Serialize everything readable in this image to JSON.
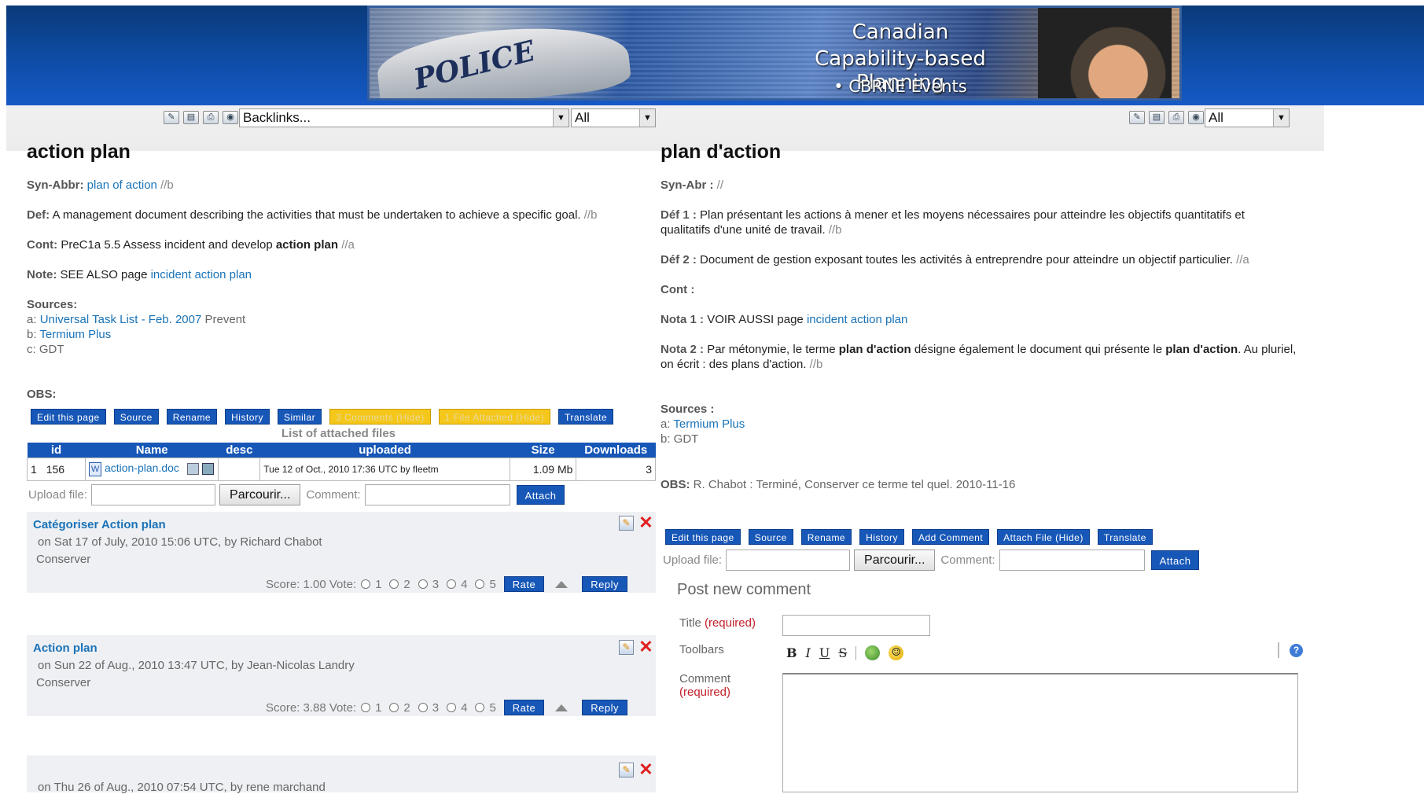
{
  "banner": {
    "line1": "Canadian",
    "line2": "Capability-based Planning",
    "line3": "• CBRNE Events",
    "car_text": "POLICE"
  },
  "toolbar_left": {
    "icons": [
      "edit-icon",
      "notepad-icon",
      "print-icon",
      "eye-icon"
    ],
    "backlinks_select": "Backlinks...",
    "filter_select": "All"
  },
  "toolbar_right": {
    "icons": [
      "edit-icon",
      "notepad-icon",
      "print-icon",
      "eye-icon"
    ],
    "filter_select": "All"
  },
  "left": {
    "title": "action plan",
    "syn_label": "Syn-Abbr:",
    "syn_link": "plan of action",
    "syn_trail": "//b",
    "def_label": "Def:",
    "def_text": "A management document describing the activities that must be undertaken to achieve a specific goal.",
    "def_trail": "//b",
    "cont_label": "Cont:",
    "cont_text": "PreC1a 5.5 Assess incident and develop",
    "cont_bold": "action plan",
    "cont_trail": "//a",
    "note_label": "Note:",
    "note_text": "SEE ALSO page",
    "note_link": "incident action plan",
    "sources_label": "Sources:",
    "src_a_prefix": "a:",
    "src_a_link": "Universal Task List - Feb. 2007",
    "src_a_tail": "Prevent",
    "src_b_prefix": "b:",
    "src_b_link": "Termium Plus",
    "src_c": "c: GDT",
    "obs_label": "OBS:",
    "buttons": [
      "Edit this page",
      "Source",
      "Rename",
      "History",
      "Similar",
      "3 Comments (Hide)",
      "1 File Attached (Hide)",
      "Translate"
    ],
    "files_caption": "List of attached files",
    "files_headers": [
      "id",
      "Name",
      "desc",
      "uploaded",
      "Size",
      "Downloads"
    ],
    "file_row": {
      "num": "1",
      "id": "156",
      "name": "action-plan.doc",
      "uploaded": "Tue 12 of Oct., 2010 17:36 UTC by fleetm",
      "size": "1.09 Mb",
      "downloads": "3"
    },
    "upload_label": "Upload file:",
    "browse": "Parcourir...",
    "comment_label": "Comment:",
    "attach": "Attach",
    "comments": [
      {
        "title": "Catégoriser Action plan",
        "meta": "on Sat 17 of July, 2010 15:06 UTC, by Richard Chabot",
        "body": "Conserver",
        "score": "Score: 1.00 Vote:"
      },
      {
        "title": "Action plan",
        "meta": "on Sun 22 of Aug., 2010 13:47 UTC, by Jean-Nicolas Landry",
        "body": "Conserver",
        "score": "Score: 3.88 Vote:"
      },
      {
        "title": "",
        "meta": "on Thu 26 of Aug., 2010 07:54 UTC, by rene marchand",
        "body": "",
        "score": ""
      }
    ],
    "vote_options": [
      "1",
      "2",
      "3",
      "4",
      "5"
    ],
    "rate": "Rate",
    "reply": "Reply"
  },
  "right": {
    "title": "plan d'action",
    "syn_label": "Syn-Abr :",
    "syn_trail": "//",
    "def1_label": "Déf 1 :",
    "def1_text": "Plan présentant les actions à mener et les moyens nécessaires pour atteindre les objectifs quantitatifs et qualitatifs d'une unité de travail.",
    "def1_trail": "//b",
    "def2_label": "Déf 2 :",
    "def2_text": "Document de gestion exposant toutes les activités à entreprendre pour atteindre un objectif particulier.",
    "def2_trail": "//a",
    "cont_label": "Cont :",
    "nota1_label": "Nota 1 :",
    "nota1_text": "VOIR AUSSI page",
    "nota1_link": "incident action plan",
    "nota2_label": "Nota 2 :",
    "nota2_a": "Par métonymie, le terme",
    "nota2_b1": "plan d'action",
    "nota2_c": "désigne également le document qui présente le",
    "nota2_b2": "plan d'action",
    "nota2_d": ". Au pluriel, on écrit : des plans d'action.",
    "nota2_trail": "//b",
    "sources_label": "Sources :",
    "src_a_prefix": "a:",
    "src_a_link": "Termium Plus",
    "src_b": "b: GDT",
    "obs_label": "OBS:",
    "obs_text": "R. Chabot : Terminé, Conserver ce terme tel quel. 2010-11-16",
    "buttons": [
      "Edit this page",
      "Source",
      "Rename",
      "History",
      "Add Comment",
      "Attach File (Hide)",
      "Translate"
    ],
    "upload_label": "Upload file:",
    "browse": "Parcourir...",
    "comment_label": "Comment:",
    "attach": "Attach",
    "post_title": "Post new comment",
    "form_title_label": "Title",
    "required": "(required)",
    "toolbars_label": "Toolbars",
    "comment_field_label": "Comment",
    "editor_buttons": [
      "B",
      "I",
      "U",
      "S"
    ]
  }
}
